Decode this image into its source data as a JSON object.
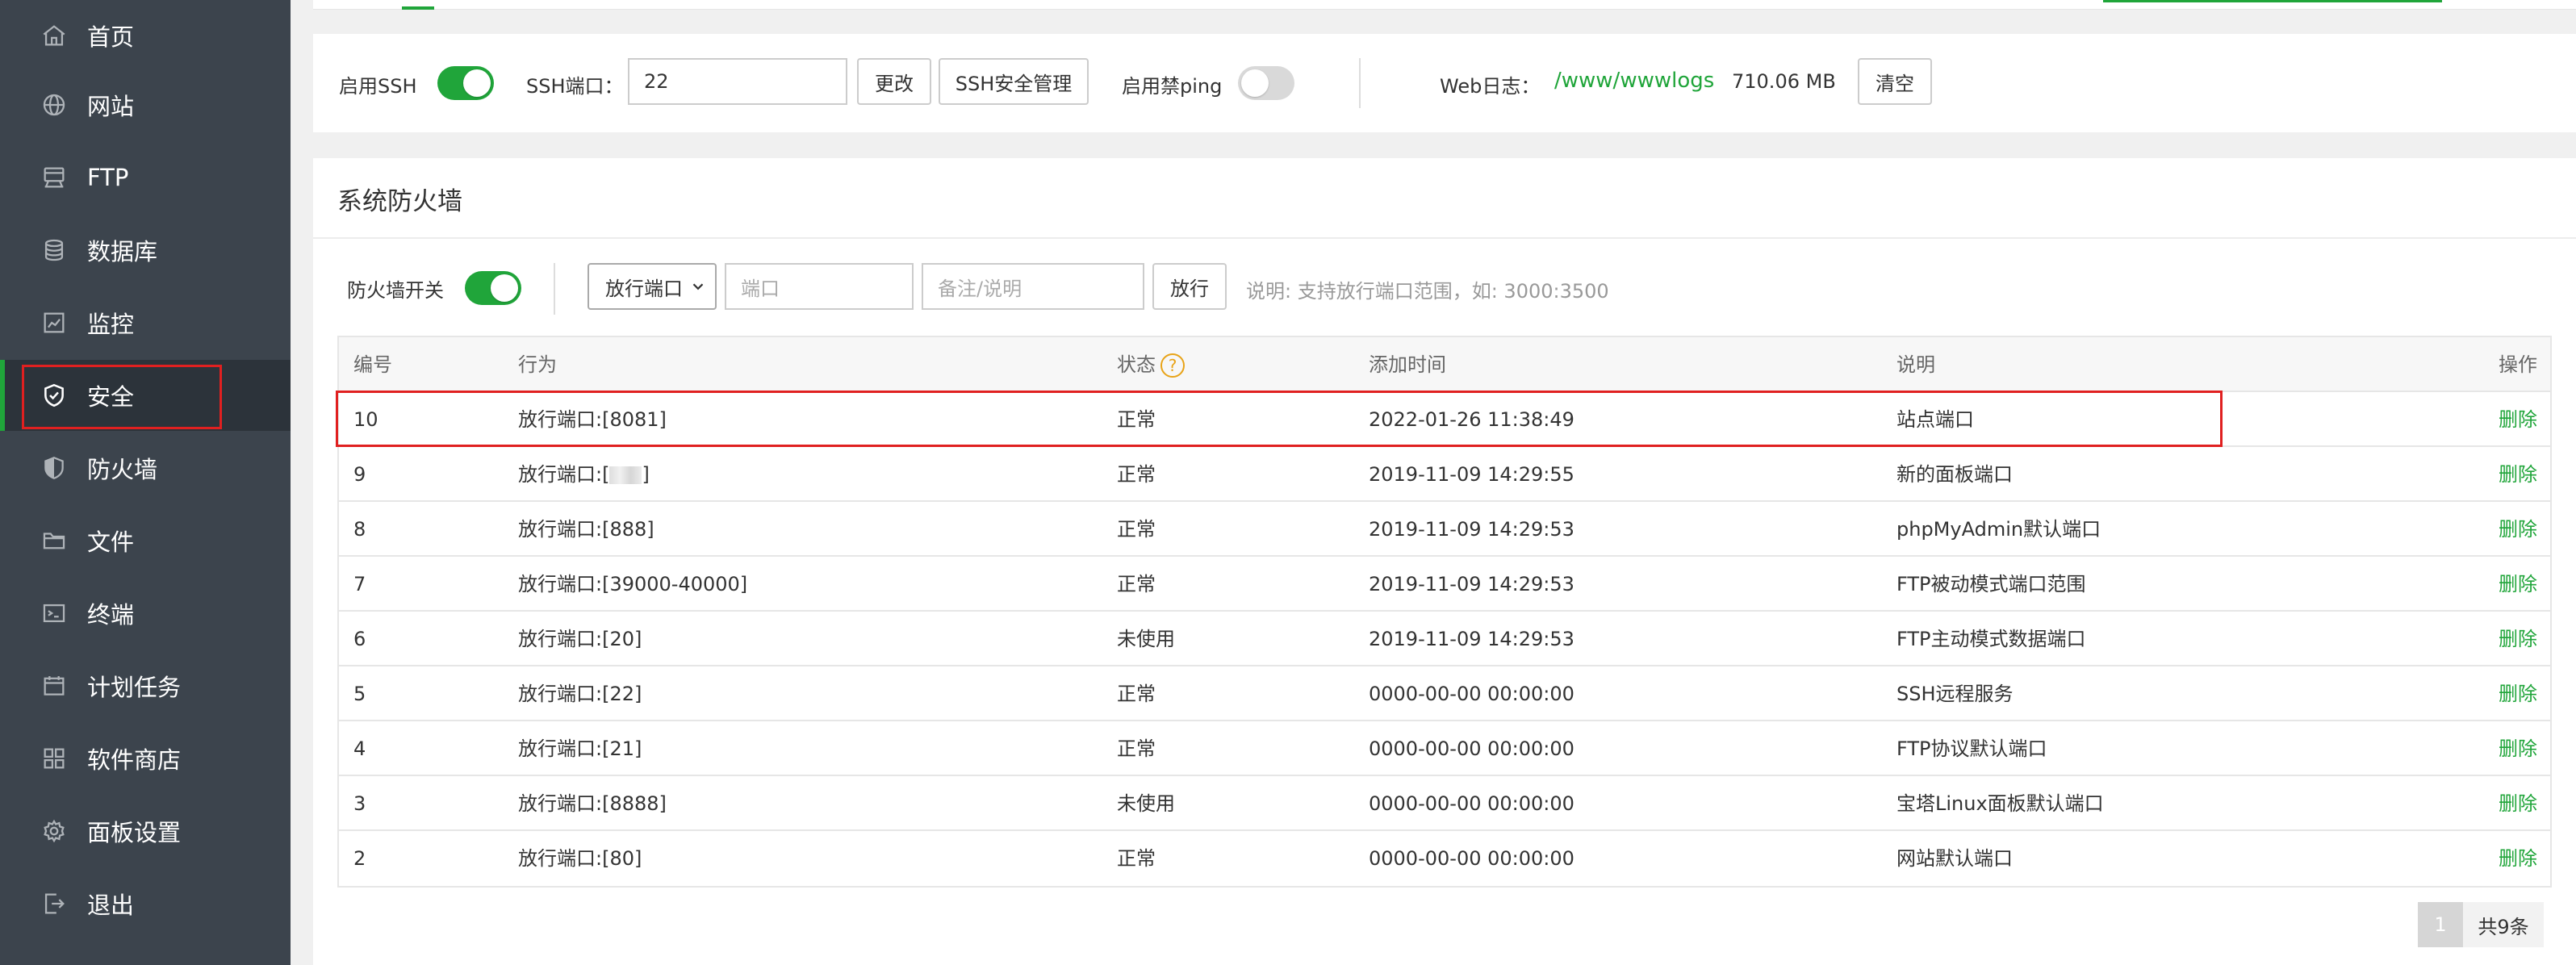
{
  "sidebar": {
    "items": [
      {
        "label": "首页",
        "icon": "home-icon"
      },
      {
        "label": "网站",
        "icon": "globe-icon"
      },
      {
        "label": "FTP",
        "icon": "ftp-icon"
      },
      {
        "label": "数据库",
        "icon": "database-icon"
      },
      {
        "label": "监控",
        "icon": "monitor-icon"
      },
      {
        "label": "安全",
        "icon": "shield-check-icon",
        "active": true
      },
      {
        "label": "防火墙",
        "icon": "shield-icon"
      },
      {
        "label": "文件",
        "icon": "folder-icon"
      },
      {
        "label": "终端",
        "icon": "terminal-icon"
      },
      {
        "label": "计划任务",
        "icon": "calendar-icon"
      },
      {
        "label": "软件商店",
        "icon": "apps-grid-icon"
      },
      {
        "label": "面板设置",
        "icon": "gear-icon"
      },
      {
        "label": "退出",
        "icon": "logout-icon"
      }
    ]
  },
  "ssh": {
    "enable_label": "启用SSH",
    "enabled": true,
    "port_label": "SSH端口：",
    "port_value": "22",
    "change_button": "更改",
    "manage_button": "SSH安全管理",
    "ping_label": "启用禁ping",
    "ping_enabled": false,
    "weblog_label": "Web日志：",
    "weblog_path": "/www/wwwlogs",
    "weblog_size": "710.06 MB",
    "clear_button": "清空"
  },
  "firewall": {
    "title": "系统防火墙",
    "switch_label": "防火墙开关",
    "enabled": true,
    "select_value": "放行端口",
    "port_placeholder": "端口",
    "note_placeholder": "备注/说明",
    "submit_button": "放行",
    "hint": "说明: 支持放行端口范围，如: 3000:3500",
    "columns": [
      "编号",
      "行为",
      "状态",
      "添加时间",
      "说明",
      "操作"
    ],
    "rows": [
      {
        "id": "10",
        "action": "放行端口:[8081]",
        "status": "正常",
        "time": "2022-01-26 11:38:49",
        "note": "站点端口",
        "op": "删除"
      },
      {
        "id": "9",
        "action_prefix": "放行端口:[",
        "action_suffix": "]",
        "status": "正常",
        "time": "2019-11-09 14:29:55",
        "note": "新的面板端口",
        "op": "删除"
      },
      {
        "id": "8",
        "action": "放行端口:[888]",
        "status": "正常",
        "time": "2019-11-09 14:29:53",
        "note": "phpMyAdmin默认端口",
        "op": "删除"
      },
      {
        "id": "7",
        "action": "放行端口:[39000-40000]",
        "status": "正常",
        "time": "2019-11-09 14:29:53",
        "note": "FTP被动模式端口范围",
        "op": "删除"
      },
      {
        "id": "6",
        "action": "放行端口:[20]",
        "status": "未使用",
        "time": "2019-11-09 14:29:53",
        "note": "FTP主动模式数据端口",
        "op": "删除"
      },
      {
        "id": "5",
        "action": "放行端口:[22]",
        "status": "正常",
        "time": "0000-00-00 00:00:00",
        "note": "SSH远程服务",
        "op": "删除"
      },
      {
        "id": "4",
        "action": "放行端口:[21]",
        "status": "正常",
        "time": "0000-00-00 00:00:00",
        "note": "FTP协议默认端口",
        "op": "删除"
      },
      {
        "id": "3",
        "action": "放行端口:[8888]",
        "status": "未使用",
        "time": "0000-00-00 00:00:00",
        "note": "宝塔Linux面板默认端口",
        "op": "删除"
      },
      {
        "id": "2",
        "action": "放行端口:[80]",
        "status": "正常",
        "time": "0000-00-00 00:00:00",
        "note": "网站默认端口",
        "op": "删除"
      }
    ],
    "pager": {
      "current": "1",
      "total": "共9条"
    }
  },
  "colors": {
    "accent": "#20a53a",
    "highlight": "#e02020",
    "sidebar_bg": "#3c444d"
  }
}
